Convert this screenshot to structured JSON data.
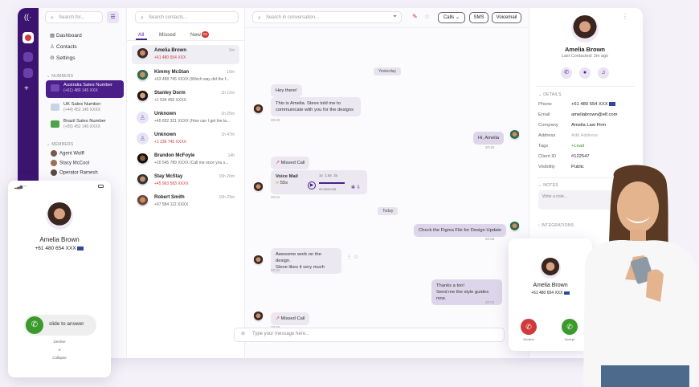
{
  "sidebar": {
    "search_placeholder": "Search for...",
    "nav": [
      "Dashboard",
      "Contacts",
      "Settings"
    ],
    "numbers_header": "NUMBERS",
    "numbers": [
      {
        "name": "Australia Sales Number",
        "number": "(+61) 480 145 XXX"
      },
      {
        "name": "UK Sales Number",
        "number": "(+44) 452 145 XXXX"
      },
      {
        "name": "Brazil Sales Number",
        "number": "(+55) 452 145 XXXX"
      }
    ],
    "members_header": "MEMBERS",
    "members": [
      "Agent Wolff",
      "Stacy McCool",
      "Operator Ramesh"
    ]
  },
  "contacts": {
    "search_placeholder": "Search contacts...",
    "tabs": [
      "All",
      "Missed",
      "New"
    ],
    "new_badge": "03",
    "items": [
      {
        "name": "Amelia Brown",
        "line": "+61 480 654 XXX",
        "time": "2m"
      },
      {
        "name": "Kimmy McStan",
        "line": "+63 458 745 XXXX (Which way did the f...",
        "time": "10m"
      },
      {
        "name": "Stanley Dorm",
        "line": "+1 534 456 XXXX",
        "time": "1h 12m"
      },
      {
        "name": "Unknown",
        "line": "+45 652 321 XXXX (How can I get the la...",
        "time": "1h 25m"
      },
      {
        "name": "Unknown",
        "line": "+1 236 745 XXXX",
        "time": "1h 47m"
      },
      {
        "name": "Brandon McFoyle",
        "line": "+20 545 789 XXXX (Call me once you s...",
        "time": "14h"
      },
      {
        "name": "Stay McStay",
        "line": "+45 963 583 XXXX",
        "time": "15h 20m"
      },
      {
        "name": "Robert Smith",
        "line": "+97 584 112 XXXX",
        "time": "15h 23m"
      }
    ]
  },
  "chat": {
    "search_placeholder": "Search in conversation...",
    "actions": [
      "Calls",
      "SMS",
      "Voicemail"
    ],
    "date_yesterday": "Yesterday",
    "date_today": "Today",
    "m1": "Hey there!",
    "m2a": "This is Amelia. Steve told me to",
    "m2b": "communicate with you for the designs",
    "t2": "20:40",
    "m3": "Hi, Amelia",
    "t3": "20:46",
    "missed": "Missed Call",
    "vm_title": "Voice Mail",
    "vm_len": "55s",
    "vm_time": "00:00/00:55",
    "vm_speeds": [
      "1x",
      "1.5x",
      "2x"
    ],
    "t_vm": "20:41",
    "m4": "Check the Figma File for Design Update",
    "t4": "20:55",
    "m5a": "Awesome work on the design.",
    "m5b": "Steve likes it very much",
    "t5": "20:31",
    "m6a": "Thanks a ton!",
    "m6b": "Send me the style guides now.",
    "t6": "20:02",
    "t_missed2": "20:55",
    "composer": "Type your message here..."
  },
  "profile": {
    "name": "Amelia Brown",
    "last": "Last Contacted: 2m ago",
    "details_header": "DETAILS",
    "details": [
      {
        "label": "Phone",
        "value": "+61 480 654 XXX"
      },
      {
        "label": "Email",
        "value": "ameliabrown@elf.com"
      },
      {
        "label": "Company",
        "value": "Amelia Law Firm"
      },
      {
        "label": "Address",
        "value": "Add Address"
      },
      {
        "label": "Tags",
        "value": "+Lead"
      },
      {
        "label": "Client ID",
        "value": "#122547"
      },
      {
        "label": "Visibility",
        "value": "Public"
      }
    ],
    "notes_header": "NOTES",
    "notes_placeholder": "Write a note...",
    "integrations_header": "INTEGRATIONS"
  },
  "phone_incoming": {
    "name": "Amelia Brown",
    "number": "+61 480 654 XXX",
    "slide": "slide to answer",
    "decline": "Decline",
    "collapse": "Collapse"
  },
  "phone_call": {
    "name": "Amelia Brown",
    "number": "+61 480 654 XXX",
    "decline": "Decline",
    "accept": "Accept"
  },
  "colors": {
    "brand": "#3b1470",
    "accent": "#4b1e8a",
    "green": "#3a9a2a",
    "red": "#d23a3a"
  }
}
